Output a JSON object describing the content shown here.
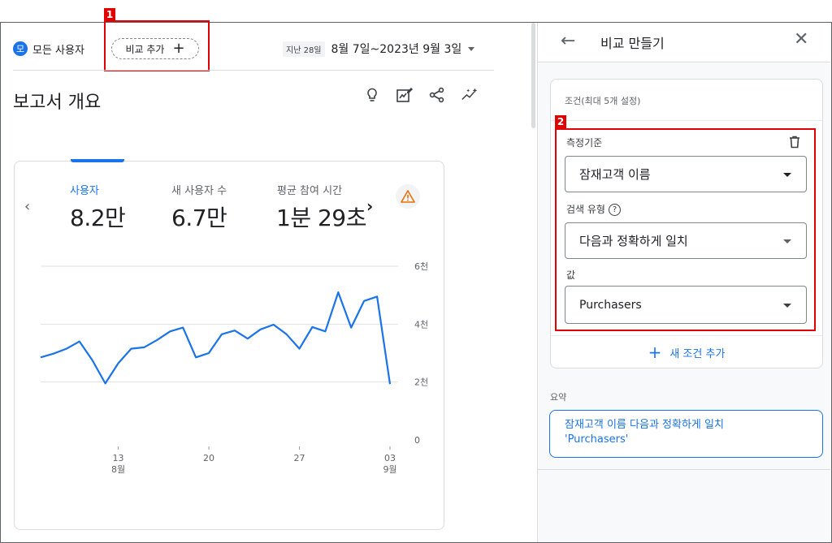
{
  "header": {
    "segment_badge": "모",
    "segment_label": "모든 사용자",
    "compare_label": "비교 추가",
    "compare_plus": "+",
    "date_chip": "지난 28일",
    "date_range": "8월 7일~2023년 9월 3일"
  },
  "page_title": "보고서 개요",
  "toolbar_icons": [
    "lightbulb-icon",
    "edit-report-icon",
    "share-icon",
    "insights-icon"
  ],
  "annotations": {
    "tag1": "1",
    "tag2": "2",
    "color": "#e00000"
  },
  "metrics": [
    {
      "label": "사용자",
      "value": "8.2만"
    },
    {
      "label": "새 사용자 수",
      "value": "6.7만"
    },
    {
      "label": "평균 참여 시간",
      "value": "1분 29초"
    }
  ],
  "nav": {
    "prev": "‹",
    "next": "›"
  },
  "chart_data": {
    "type": "line",
    "series": [
      {
        "values": [
          2.85,
          2.98,
          3.15,
          3.4,
          2.75,
          1.95,
          2.65,
          3.15,
          3.2,
          3.45,
          3.75,
          3.88,
          2.85,
          3.0,
          3.65,
          3.78,
          3.5,
          3.82,
          3.98,
          3.65,
          3.15,
          3.9,
          3.75,
          5.1,
          3.88,
          4.8,
          4.95,
          1.93
        ]
      }
    ],
    "y_tick_labels": [
      "6천",
      "4천",
      "2천",
      "0"
    ],
    "y_ticks": [
      6,
      4,
      2,
      0
    ],
    "ylim": [
      0,
      6
    ],
    "x_tick_labels": [
      {
        "day": "13",
        "month": "8월"
      },
      {
        "day": "20",
        "month": ""
      },
      {
        "day": "27",
        "month": ""
      },
      {
        "day": "03",
        "month": "9월"
      }
    ],
    "line_color": "#1a73e8",
    "grid": true
  },
  "panel": {
    "title": "비교 만들기",
    "condition_title": "조건(최대 5개 설정)",
    "dimension_label": "측정기준",
    "dimension_value": "잠재고객 이름",
    "match_label": "검색 유형",
    "help_glyph": "?",
    "match_value": "다음과 정확하게 일치",
    "value_label": "값",
    "value_value": "Purchasers",
    "add_condition": "새 조건 추가",
    "summary_label": "요약",
    "summary_line1": "잠재고객 이름 다음과 정확하게 일치",
    "summary_line2": "'Purchasers'"
  },
  "colors": {
    "accent": "#1a73e8",
    "warning": "#e8710a"
  }
}
